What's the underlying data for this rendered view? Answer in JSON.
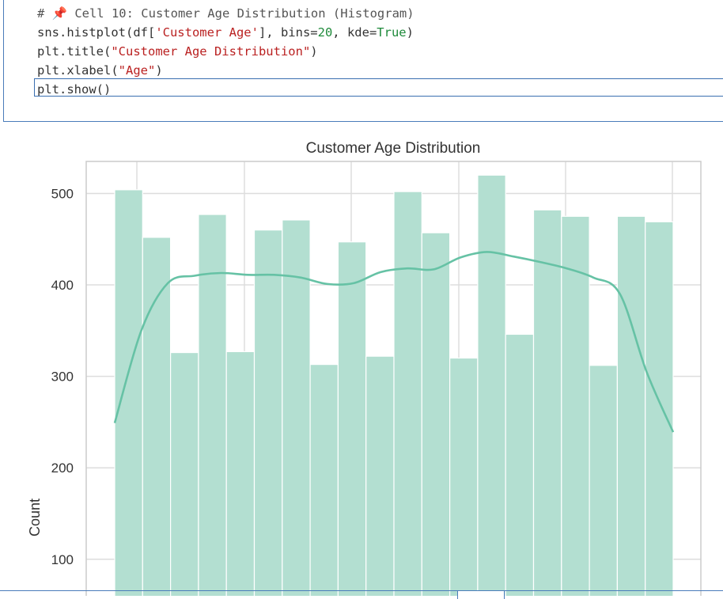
{
  "notebook": {
    "code_lines": [
      {
        "parts": [
          {
            "t": "# ",
            "c": "c-comment"
          },
          {
            "t": "📌",
            "c": "c-pin"
          },
          {
            "t": " Cell 10: Customer Age Distribution (Histogram)",
            "c": "c-comment"
          }
        ]
      },
      {
        "parts": [
          {
            "t": "sns.histplot(df[",
            "c": "c-name"
          },
          {
            "t": "'Customer Age'",
            "c": "c-str"
          },
          {
            "t": "], bins=",
            "c": "c-name"
          },
          {
            "t": "20",
            "c": "c-num"
          },
          {
            "t": ", kde=",
            "c": "c-name"
          },
          {
            "t": "True",
            "c": "c-kw"
          },
          {
            "t": ")",
            "c": "c-name"
          }
        ]
      },
      {
        "parts": [
          {
            "t": "plt.title(",
            "c": "c-name"
          },
          {
            "t": "\"Customer Age Distribution\"",
            "c": "c-str"
          },
          {
            "t": ")",
            "c": "c-name"
          }
        ]
      },
      {
        "parts": [
          {
            "t": "plt.xlabel(",
            "c": "c-name"
          },
          {
            "t": "\"Age\"",
            "c": "c-str"
          },
          {
            "t": ")",
            "c": "c-name"
          }
        ]
      },
      {
        "parts": [
          {
            "t": "plt.show()",
            "c": "c-name"
          }
        ]
      }
    ]
  },
  "chart_data": {
    "type": "bar",
    "title": "Customer Age Distribution",
    "xlabel": "",
    "ylabel": "Count",
    "ylim": [
      60,
      535
    ],
    "yticks": [
      100,
      200,
      300,
      400,
      500
    ],
    "grid": true,
    "bar_color": "#b3dfd1",
    "bar_edge": "#ffffff",
    "kde_color": "#66c2a5",
    "bins": 20,
    "values": [
      504,
      452,
      326,
      477,
      327,
      460,
      471,
      313,
      447,
      322,
      502,
      457,
      320,
      520,
      346,
      482,
      475,
      312,
      475,
      469
    ],
    "kde": [
      249,
      350,
      402,
      410,
      413,
      411,
      411,
      408,
      401,
      402,
      414,
      418,
      417,
      430,
      436,
      431,
      425,
      418,
      408,
      390,
      305,
      239
    ]
  }
}
